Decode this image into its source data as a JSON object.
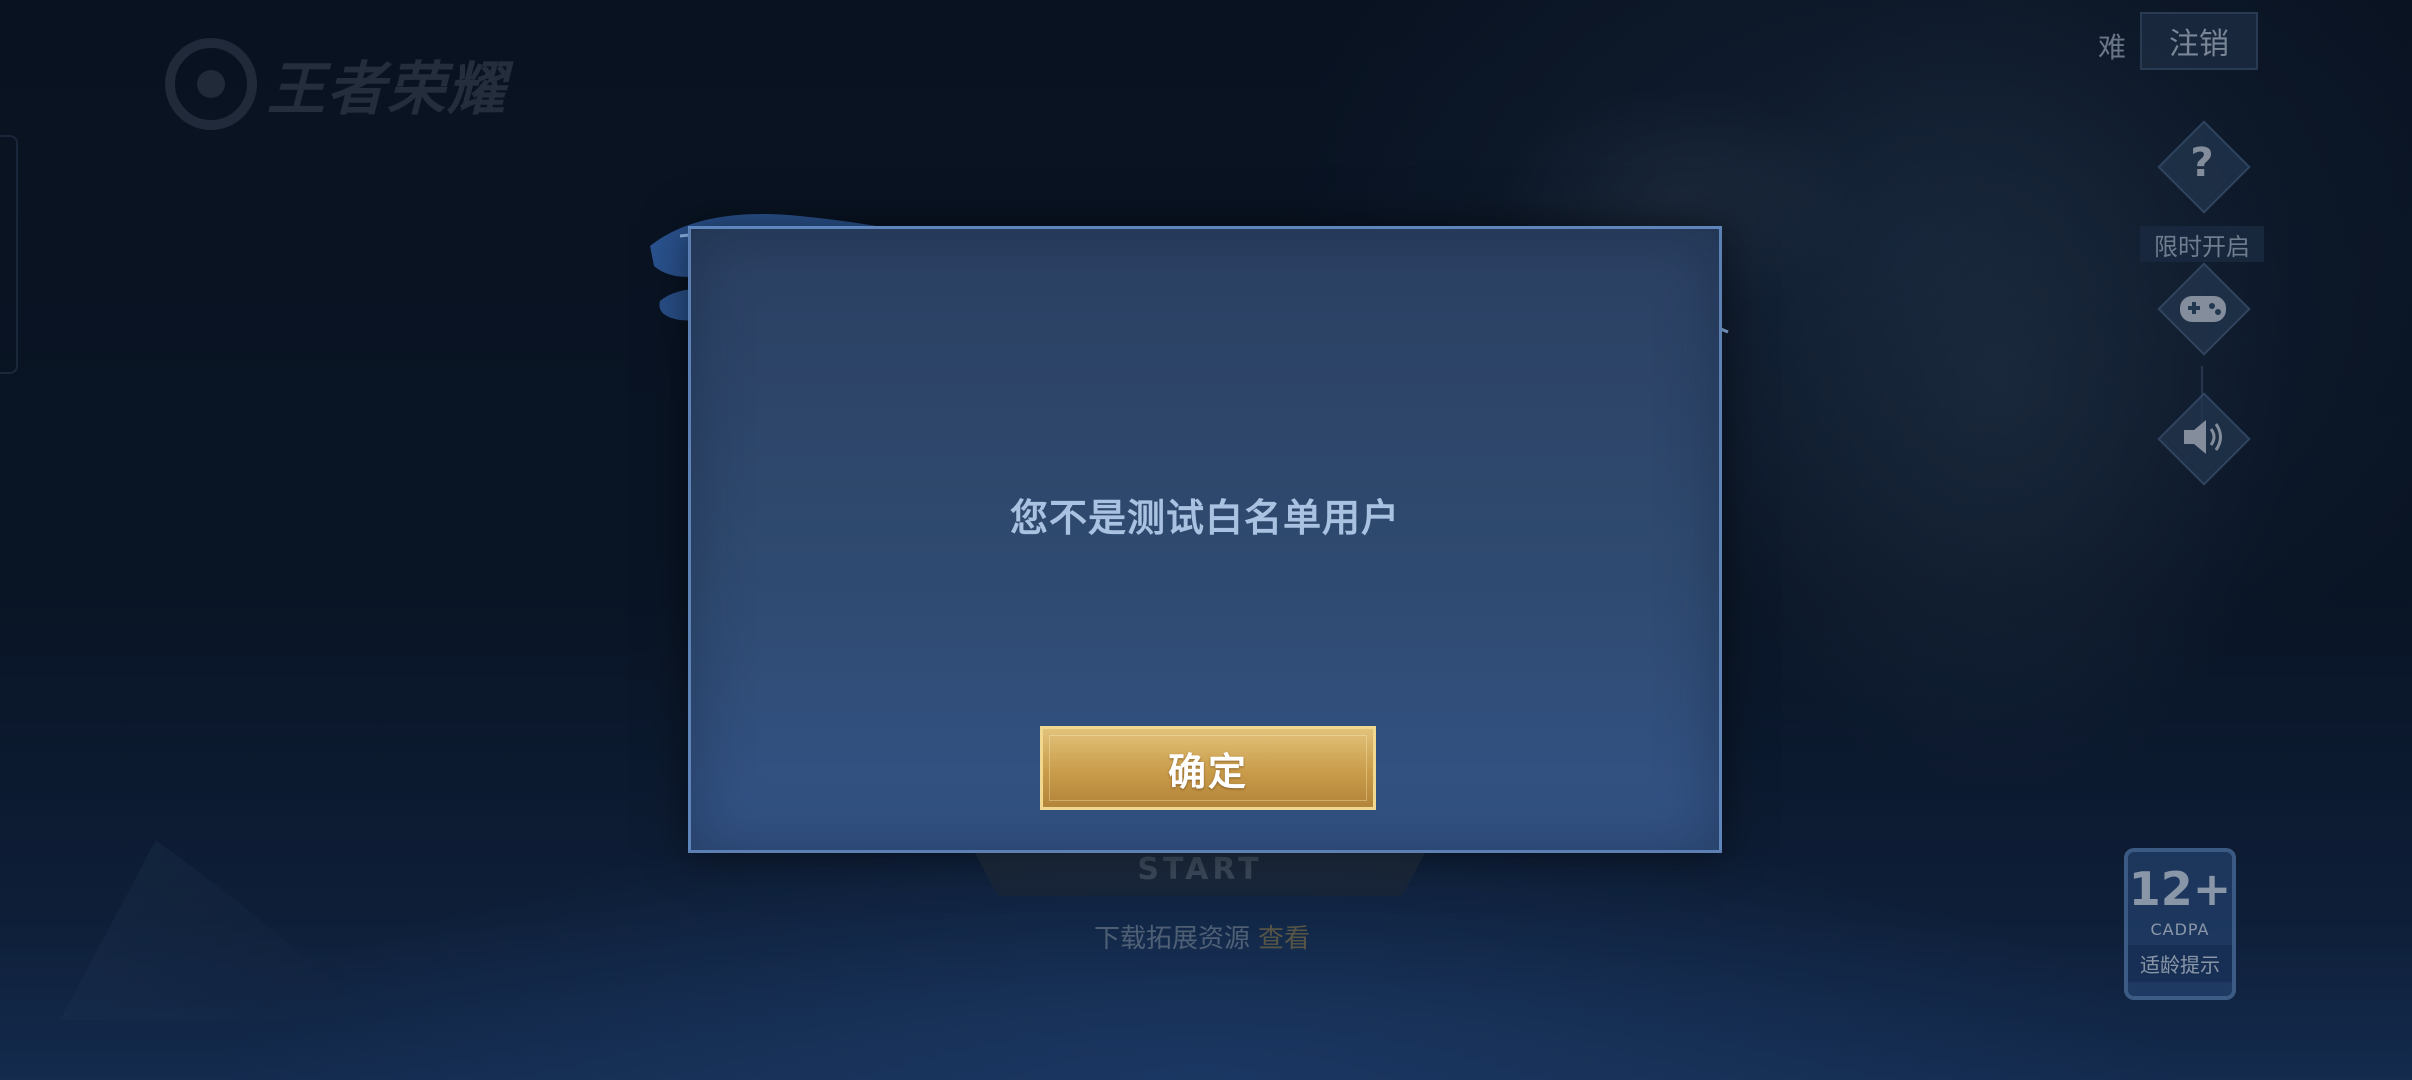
{
  "logo": {
    "text": "王者荣耀"
  },
  "top_right": {
    "difficulty_label": "难",
    "logout_label": "注销"
  },
  "side_icons": {
    "help_glyph": "?",
    "limited_label": "限时开启",
    "gamepad_icon": "gamepad-icon",
    "sound_icon": "speaker-icon"
  },
  "age_rating": {
    "number": "12+",
    "org": "CADPA",
    "tip": "适龄提示"
  },
  "background": {
    "start_text": "START",
    "download_text": "下载拓展资源",
    "download_accent": "查看"
  },
  "modal": {
    "message": "您不是测试白名单用户",
    "confirm_label": "确定"
  },
  "colors": {
    "modal_bg": "#2f4a70",
    "modal_border": "#6e96cd",
    "message": "#a9c2e2",
    "button_gold": "#c99c4a"
  }
}
